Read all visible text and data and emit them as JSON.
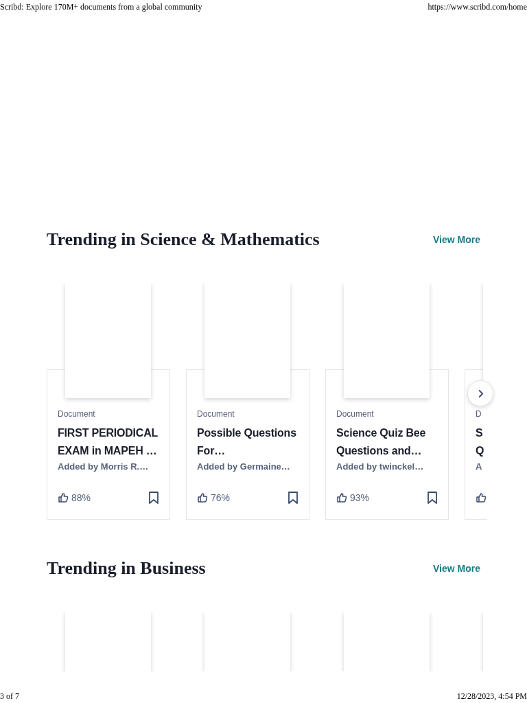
{
  "print_header": {
    "title": "Scribd: Explore 170M+ documents from a global community",
    "url": "https://www.scribd.com/home"
  },
  "sections": [
    {
      "title": "Trending in Science & Mathematics",
      "link": "View More",
      "next_arrow": true,
      "cards": [
        {
          "kind": "document",
          "doc_type": "Document",
          "title": "FIRST PERIODICAL EXAM in MAPEH …",
          "added_by": "Added by Morris R.…",
          "rating": "88%"
        },
        {
          "kind": "document",
          "doc_type": "Document",
          "title": "Possible Questions For…",
          "added_by": "Added by Germaine…",
          "rating": "76%"
        },
        {
          "kind": "document",
          "doc_type": "Document",
          "title": "Science Quiz Bee Questions and…",
          "added_by": "Added by twinckel…",
          "rating": "93%"
        },
        {
          "kind": "partial_document",
          "doc_type": "D",
          "title": "S Q",
          "added_by": "A"
        }
      ]
    },
    {
      "title": "Trending in Business",
      "link": "View More",
      "next_arrow": false,
      "cards": [
        {
          "kind": "thumbnail"
        },
        {
          "kind": "thumbnail"
        },
        {
          "kind": "thumbnail"
        },
        {
          "kind": "thumbnail"
        }
      ]
    }
  ],
  "print_footer": {
    "page": "3 of 7",
    "date": "12/28/2023, 4:54 PM"
  }
}
